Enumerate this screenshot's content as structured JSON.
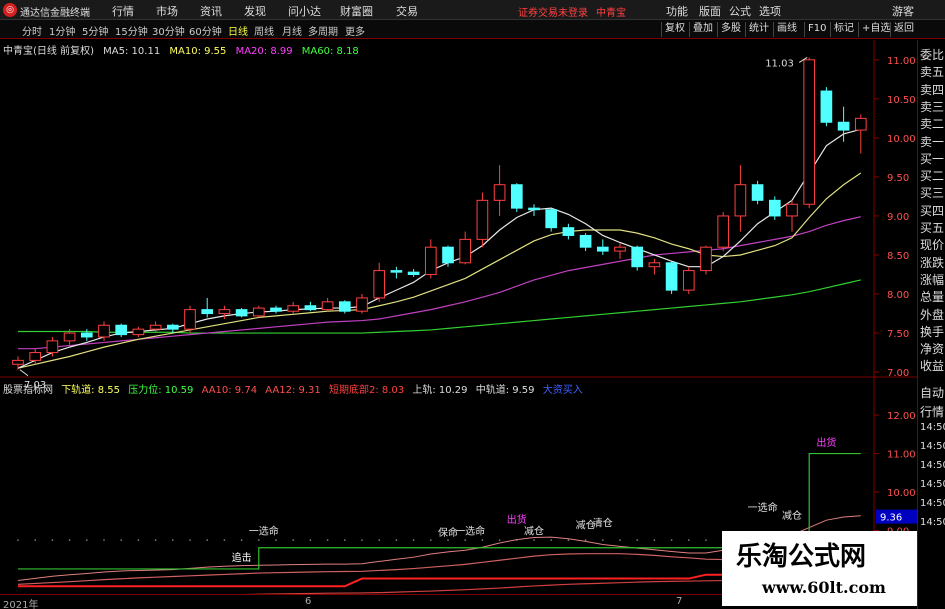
{
  "app": {
    "name": "通达信金融终端",
    "menu": [
      "行情",
      "市场",
      "资讯",
      "发现",
      "问小达",
      "财富圈",
      "交易"
    ],
    "warning": "证券交易未登录",
    "stock_name": "中青宝",
    "right_menu": [
      "功能",
      "版面",
      "公式",
      "选项"
    ],
    "guest": "游客"
  },
  "toolbar": {
    "periods": [
      "分时",
      "1分钟",
      "5分钟",
      "15分钟",
      "30分钟",
      "60分钟",
      "日线",
      "周线",
      "月线",
      "多周期",
      "更多"
    ],
    "active_period": "日线",
    "right_buttons": [
      "复权",
      "叠加",
      "多股",
      "统计",
      "画线",
      "F10",
      "标记",
      "+自选",
      "返回"
    ]
  },
  "price_legend": {
    "title": "中青宝(日线 前复权)",
    "ma5": "MA5: 10.11",
    "ma10": "MA10: 9.55",
    "ma20": "MA20: 8.99",
    "ma60": "MA60: 8.18"
  },
  "indicator_legend": {
    "name": "股票指标网",
    "lower": "下轨道: 8.55",
    "pressure": "压力位: 10.59",
    "aa10": "AA10: 9.74",
    "aa12": "AA12: 9.31",
    "bottom": "短期底部2: 8.03",
    "upper": "上轨: 10.29",
    "middle": "中轨道: 9.59",
    "big": "大资买入"
  },
  "side_panel": [
    "委比",
    "卖五",
    "卖四",
    "卖三",
    "卖二",
    "卖一",
    "买一",
    "买二",
    "买三",
    "买四",
    "买五",
    "现价",
    "涨跌",
    "涨幅",
    "总量",
    "外盘",
    "换手",
    "净资",
    "收益"
  ],
  "side_panel2": [
    "自动",
    "行情",
    "14:50",
    "14:50",
    "14:50",
    "14:50",
    "14:50",
    "14:50"
  ],
  "dates": [
    "2021年",
    "6",
    "7"
  ],
  "watermark": {
    "title": "乐淘公式网",
    "url": "www.60lt.com"
  },
  "chart_data": {
    "type": "candlestick",
    "price_axis": {
      "ticks": [
        11.0,
        10.5,
        10.0,
        9.5,
        9.0,
        8.5,
        8.0,
        7.5,
        7.0
      ],
      "labels": [
        "11.00",
        "10.50",
        "10.00",
        "9.50",
        "9.00",
        "8.50",
        "8.00",
        "7.50",
        "7.00"
      ]
    },
    "indicator_axis": {
      "ticks": [
        12.0,
        11.0,
        10.0,
        9.0
      ],
      "labels": [
        "12.00",
        "11.00",
        "10.00",
        "9.00"
      ],
      "current": "9.36"
    },
    "high_label": "11.03",
    "low_label": "7.03",
    "candles": [
      [
        7.1,
        7.2,
        7.03,
        7.15
      ],
      [
        7.15,
        7.3,
        7.1,
        7.25
      ],
      [
        7.25,
        7.45,
        7.2,
        7.4
      ],
      [
        7.4,
        7.55,
        7.35,
        7.5
      ],
      [
        7.5,
        7.55,
        7.4,
        7.45
      ],
      [
        7.45,
        7.65,
        7.4,
        7.6
      ],
      [
        7.6,
        7.62,
        7.45,
        7.48
      ],
      [
        7.48,
        7.58,
        7.45,
        7.55
      ],
      [
        7.55,
        7.65,
        7.5,
        7.6
      ],
      [
        7.6,
        7.62,
        7.5,
        7.55
      ],
      [
        7.55,
        7.85,
        7.5,
        7.8
      ],
      [
        7.8,
        7.95,
        7.7,
        7.75
      ],
      [
        7.75,
        7.85,
        7.68,
        7.8
      ],
      [
        7.8,
        7.82,
        7.7,
        7.72
      ],
      [
        7.72,
        7.85,
        7.7,
        7.82
      ],
      [
        7.82,
        7.85,
        7.75,
        7.78
      ],
      [
        7.78,
        7.9,
        7.75,
        7.85
      ],
      [
        7.85,
        7.9,
        7.78,
        7.8
      ],
      [
        7.8,
        7.95,
        7.78,
        7.9
      ],
      [
        7.9,
        7.92,
        7.75,
        7.78
      ],
      [
        7.78,
        8.0,
        7.75,
        7.95
      ],
      [
        7.95,
        8.4,
        7.9,
        8.3
      ],
      [
        8.3,
        8.35,
        8.2,
        8.28
      ],
      [
        8.28,
        8.32,
        8.22,
        8.25
      ],
      [
        8.25,
        8.7,
        8.2,
        8.6
      ],
      [
        8.6,
        8.62,
        8.35,
        8.4
      ],
      [
        8.4,
        8.8,
        8.38,
        8.7
      ],
      [
        8.7,
        9.3,
        8.6,
        9.2
      ],
      [
        9.2,
        9.65,
        9.0,
        9.4
      ],
      [
        9.4,
        9.42,
        9.05,
        9.1
      ],
      [
        9.1,
        9.15,
        9.0,
        9.08
      ],
      [
        9.08,
        9.1,
        8.8,
        8.85
      ],
      [
        8.85,
        8.9,
        8.7,
        8.75
      ],
      [
        8.75,
        8.78,
        8.55,
        8.6
      ],
      [
        8.6,
        8.7,
        8.5,
        8.55
      ],
      [
        8.55,
        8.65,
        8.45,
        8.6
      ],
      [
        8.6,
        8.62,
        8.3,
        8.35
      ],
      [
        8.35,
        8.45,
        8.25,
        8.4
      ],
      [
        8.4,
        8.42,
        8.0,
        8.05
      ],
      [
        8.05,
        8.35,
        8.0,
        8.3
      ],
      [
        8.3,
        8.62,
        8.25,
        8.6
      ],
      [
        8.6,
        9.05,
        8.55,
        9.0
      ],
      [
        9.0,
        9.65,
        8.8,
        9.4
      ],
      [
        9.4,
        9.45,
        9.15,
        9.2
      ],
      [
        9.2,
        9.25,
        8.95,
        9.0
      ],
      [
        9.0,
        9.2,
        8.8,
        9.15
      ],
      [
        9.15,
        11.03,
        9.1,
        11.0
      ],
      [
        10.6,
        10.65,
        10.15,
        10.2
      ],
      [
        10.2,
        10.4,
        9.95,
        10.1
      ],
      [
        10.1,
        10.3,
        9.8,
        10.25
      ]
    ],
    "ma5": [
      7.05,
      7.15,
      7.25,
      7.32,
      7.38,
      7.45,
      7.5,
      7.52,
      7.54,
      7.56,
      7.62,
      7.68,
      7.72,
      7.75,
      7.77,
      7.78,
      7.8,
      7.81,
      7.82,
      7.82,
      7.84,
      7.95,
      8.05,
      8.15,
      8.3,
      8.4,
      8.48,
      8.62,
      8.82,
      8.98,
      9.08,
      9.1,
      9.02,
      8.9,
      8.75,
      8.66,
      8.58,
      8.5,
      8.42,
      8.35,
      8.35,
      8.48,
      8.68,
      8.9,
      9.05,
      9.2,
      9.55,
      9.9,
      10.05,
      10.11
    ],
    "ma10": [
      7.05,
      7.1,
      7.15,
      7.2,
      7.26,
      7.32,
      7.37,
      7.42,
      7.46,
      7.5,
      7.54,
      7.58,
      7.62,
      7.66,
      7.7,
      7.72,
      7.74,
      7.76,
      7.78,
      7.79,
      7.8,
      7.85,
      7.9,
      7.96,
      8.04,
      8.12,
      8.2,
      8.32,
      8.44,
      8.56,
      8.68,
      8.76,
      8.8,
      8.82,
      8.82,
      8.82,
      8.78,
      8.72,
      8.64,
      8.58,
      8.5,
      8.48,
      8.5,
      8.56,
      8.62,
      8.72,
      8.98,
      9.22,
      9.4,
      9.55
    ],
    "ma20": [
      7.3,
      7.3,
      7.32,
      7.34,
      7.36,
      7.38,
      7.4,
      7.42,
      7.44,
      7.46,
      7.48,
      7.5,
      7.52,
      7.54,
      7.56,
      7.58,
      7.6,
      7.62,
      7.64,
      7.65,
      7.66,
      7.68,
      7.72,
      7.76,
      7.8,
      7.85,
      7.9,
      7.96,
      8.02,
      8.1,
      8.18,
      8.24,
      8.3,
      8.34,
      8.38,
      8.42,
      8.46,
      8.5,
      8.52,
      8.54,
      8.56,
      8.58,
      8.62,
      8.66,
      8.7,
      8.74,
      8.8,
      8.88,
      8.94,
      8.99
    ],
    "ma60": [
      7.52,
      7.52,
      7.52,
      7.52,
      7.52,
      7.51,
      7.51,
      7.51,
      7.51,
      7.51,
      7.5,
      7.5,
      7.5,
      7.5,
      7.5,
      7.5,
      7.5,
      7.5,
      7.5,
      7.5,
      7.5,
      7.51,
      7.52,
      7.53,
      7.54,
      7.56,
      7.58,
      7.6,
      7.62,
      7.64,
      7.66,
      7.68,
      7.7,
      7.72,
      7.74,
      7.76,
      7.78,
      7.8,
      7.82,
      7.84,
      7.86,
      7.88,
      7.9,
      7.93,
      7.96,
      7.99,
      8.03,
      8.08,
      8.13,
      8.18
    ],
    "annotations": [
      "一选命",
      "追击",
      "一选命",
      "保命",
      "出货",
      "减仓",
      "减仓",
      "清仓",
      "一选命",
      "减仓",
      "出货"
    ]
  }
}
